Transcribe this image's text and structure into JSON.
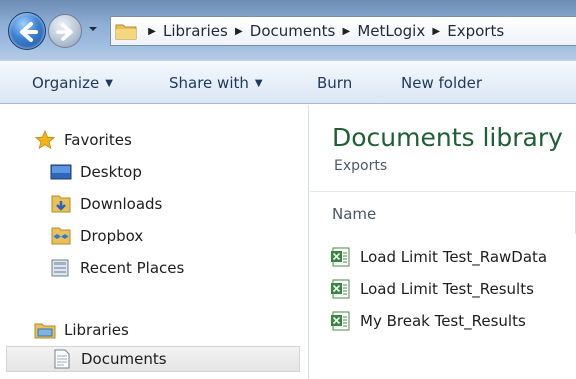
{
  "address": {
    "crumbs": [
      "Libraries",
      "Documents",
      "MetLogix",
      "Exports"
    ]
  },
  "toolbar": {
    "organize": "Organize",
    "share_with": "Share with",
    "burn": "Burn",
    "new_folder": "New folder"
  },
  "nav": {
    "favorites": "Favorites",
    "desktop": "Desktop",
    "downloads": "Downloads",
    "dropbox": "Dropbox",
    "recent_places": "Recent Places",
    "libraries": "Libraries",
    "documents": "Documents"
  },
  "content": {
    "title": "Documents library",
    "subtitle": "Exports",
    "column_name": "Name",
    "files": [
      "Load Limit Test_RawData",
      "Load Limit Test_Results",
      "My Break Test_Results"
    ]
  },
  "colors": {
    "library_title": "#1e5f34",
    "toolbar_text": "#1e395b",
    "accent": "#3b7fd0"
  }
}
